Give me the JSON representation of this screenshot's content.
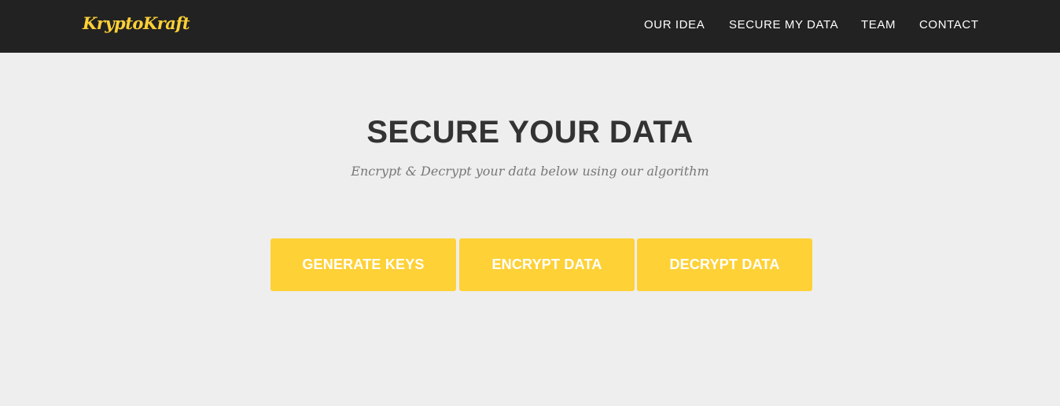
{
  "nav": {
    "brand": "KryptoKraft",
    "links": [
      {
        "label": "OUR IDEA"
      },
      {
        "label": "SECURE MY DATA"
      },
      {
        "label": "TEAM"
      },
      {
        "label": "CONTACT"
      }
    ]
  },
  "hero": {
    "title": "SECURE YOUR DATA",
    "subtitle": "Encrypt & Decrypt your data below using our algorithm"
  },
  "actions": {
    "generate_label": "GENERATE KEYS",
    "encrypt_label": "ENCRYPT DATA",
    "decrypt_label": "DECRYPT DATA"
  },
  "colors": {
    "navbar_bg": "#222222",
    "page_bg": "#eeeeee",
    "accent": "#fed136",
    "heading": "#333333",
    "muted": "#777777"
  }
}
